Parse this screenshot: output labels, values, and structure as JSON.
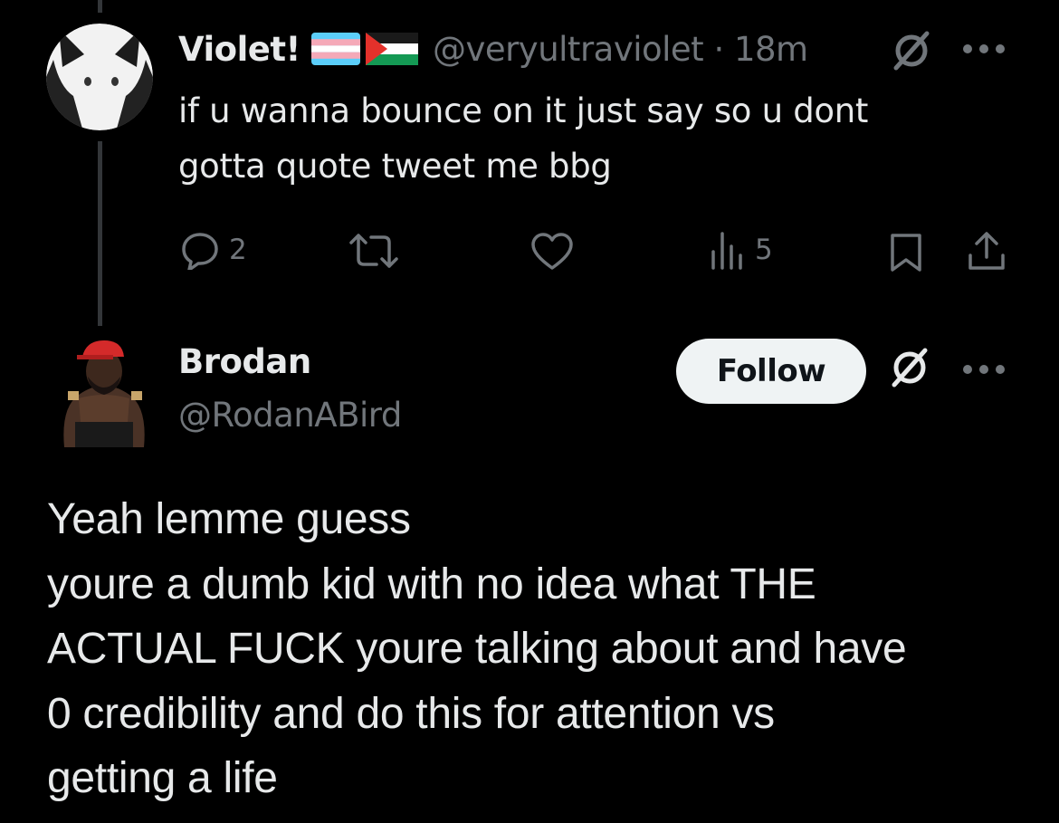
{
  "tweet1": {
    "display_name": "Violet!",
    "flags": [
      "transgender-flag",
      "palestine-flag"
    ],
    "handle_time": "@veryultraviolet · 18m",
    "text_lines": [
      "if u wanna bounce on it just say so u dont",
      "gotta quote tweet me bbg"
    ],
    "actions": {
      "reply_count": "2",
      "retweet_count": "",
      "like_count": "",
      "views_count": "5"
    },
    "icons": {
      "reply": "reply-icon",
      "retweet": "retweet-icon",
      "like": "heart-icon",
      "views": "views-icon",
      "bookmark": "bookmark-icon",
      "share": "share-icon",
      "mute": "grok-icon",
      "more": "more-icon"
    }
  },
  "tweet2": {
    "display_name": "Brodan",
    "handle": "@RodanABird",
    "follow_label": "Follow",
    "text_lines": [
      "Yeah lemme guess",
      "youre a dumb kid with no idea what THE",
      "ACTUAL FUCK youre talking about and have",
      "0 credibility and do this for attention vs",
      "getting a life"
    ]
  },
  "colors": {
    "background": "#000000",
    "primary_text": "#e7e9ea",
    "secondary_text": "#71767b",
    "follow_button_bg": "#eff3f4",
    "follow_button_text": "#0f1419",
    "thread_line": "#333639"
  }
}
